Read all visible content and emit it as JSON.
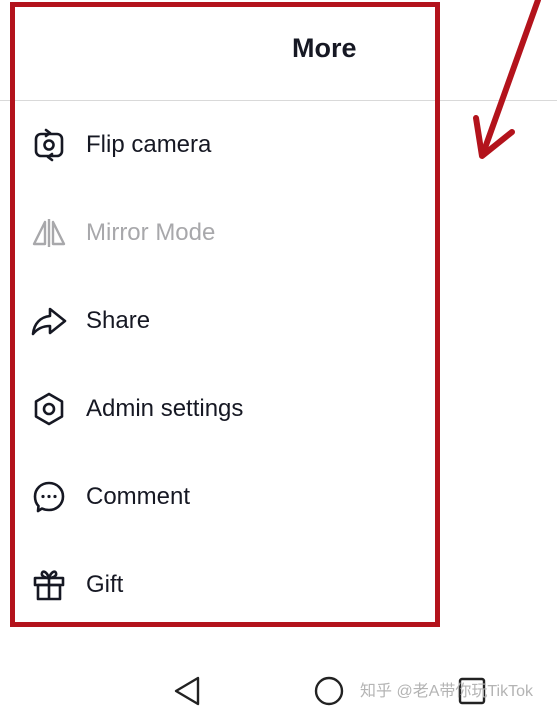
{
  "header": {
    "title": "More"
  },
  "menu": {
    "items": [
      {
        "label": "Flip camera",
        "icon": "flip-camera-icon",
        "enabled": true
      },
      {
        "label": "Mirror Mode",
        "icon": "mirror-icon",
        "enabled": false
      },
      {
        "label": "Share",
        "icon": "share-icon",
        "enabled": true
      },
      {
        "label": "Admin settings",
        "icon": "hexagon-settings-icon",
        "enabled": true
      },
      {
        "label": "Comment",
        "icon": "comment-bubble-icon",
        "enabled": true
      },
      {
        "label": "Gift",
        "icon": "gift-icon",
        "enabled": true
      }
    ]
  },
  "annotation": {
    "highlight_color": "#b3131c"
  },
  "navbar": {
    "back_icon": "triangle-back-icon",
    "home_icon": "circle-home-icon",
    "recents_icon": "square-recents-icon"
  },
  "watermark": {
    "text": "知乎 @老A带你玩TikTok"
  },
  "colors": {
    "text": "#161823",
    "disabled_text": "#a8a8ab",
    "divider": "#d9d9d9"
  }
}
